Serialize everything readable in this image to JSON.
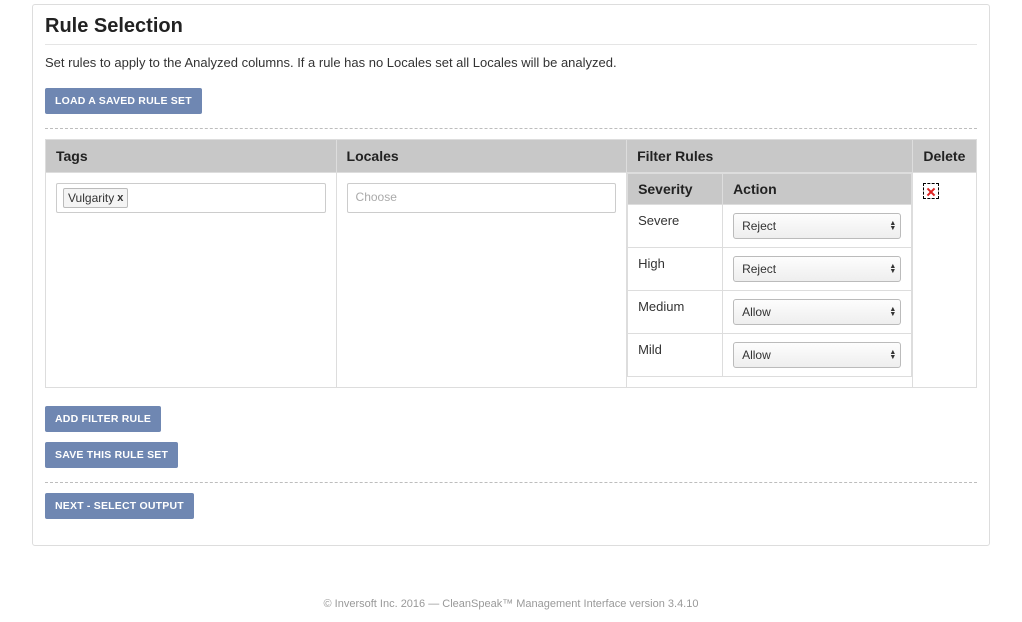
{
  "title": "Rule Selection",
  "description": "Set rules to apply to the Analyzed columns. If a rule has no Locales set all Locales will be analyzed.",
  "buttons": {
    "load": "Load a Saved Rule Set",
    "add": "Add Filter Rule",
    "save": "Save This Rule Set",
    "next": "Next - Select Output"
  },
  "columns": {
    "tags": "Tags",
    "locales": "Locales",
    "filter": "Filter Rules",
    "delete": "Delete"
  },
  "tags": {
    "items": [
      {
        "label": "Vulgarity"
      }
    ]
  },
  "locales": {
    "placeholder": "Choose"
  },
  "filter": {
    "headers": {
      "severity": "Severity",
      "action": "Action"
    },
    "rows": [
      {
        "severity": "Severe",
        "action": "Reject"
      },
      {
        "severity": "High",
        "action": "Reject"
      },
      {
        "severity": "Medium",
        "action": "Allow"
      },
      {
        "severity": "Mild",
        "action": "Allow"
      }
    ],
    "options": [
      "Reject",
      "Allow"
    ]
  },
  "footer": "© Inversoft Inc. 2016 — CleanSpeak™ Management Interface version 3.4.10"
}
